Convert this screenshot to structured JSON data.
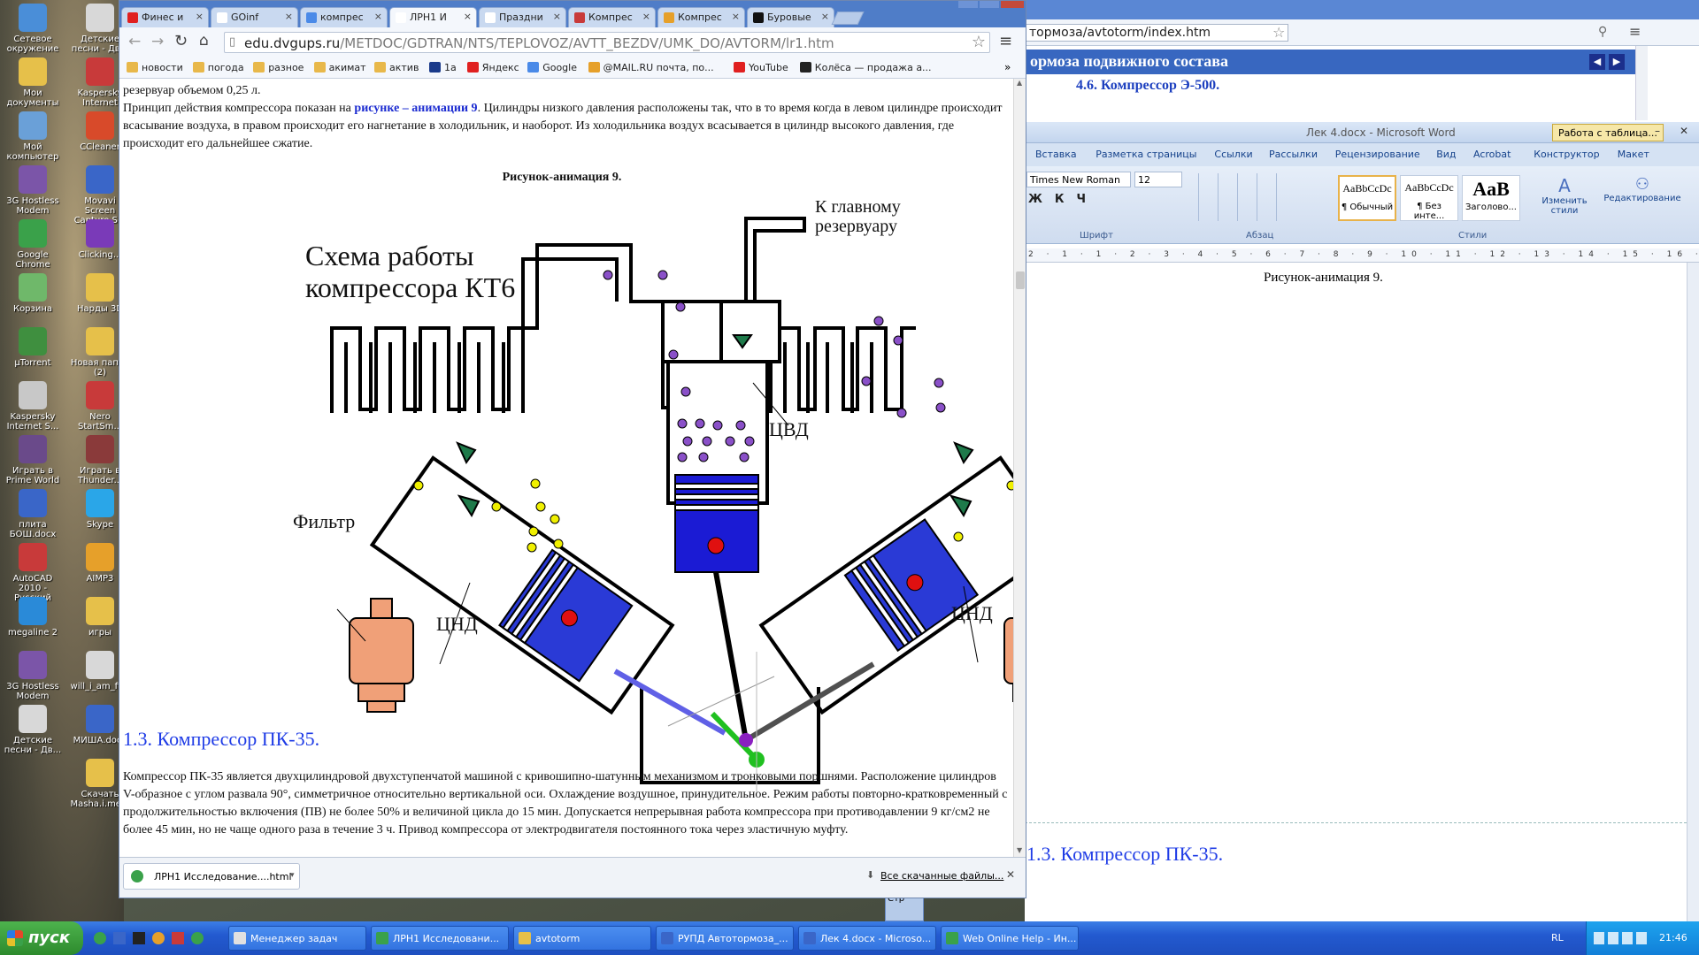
{
  "desktop": {
    "icons": [
      {
        "label": "Сетевое окружение",
        "color": "#4a8ed8"
      },
      {
        "label": "Мои документы",
        "color": "#e6c04a"
      },
      {
        "label": "Мой компьютер",
        "color": "#6aa0d8"
      },
      {
        "label": "3G Hostless Modem",
        "color": "#7b55a8"
      },
      {
        "label": "Google Chrome",
        "color": "#3aa14a"
      },
      {
        "label": "Корзина",
        "color": "#6fb86a"
      },
      {
        "label": "µTorrent",
        "color": "#3f8f3f"
      },
      {
        "label": "Kaspersky Internet S...",
        "color": "#c8c8c8"
      },
      {
        "label": "Играть в Prime World",
        "color": "#6a4a8a"
      },
      {
        "label": "плита БОШ.docx",
        "color": "#3a66c8"
      },
      {
        "label": "AutoCAD 2010 - Русский",
        "color": "#c83a3a"
      },
      {
        "label": "megaline 2",
        "color": "#2a8ad8"
      },
      {
        "label": "3G Hostless Modem",
        "color": "#7b55a8"
      },
      {
        "label": "Детские песни - Дв...",
        "color": "#d8d8d8"
      }
    ],
    "icons2": [
      {
        "label": "Детские песни - Дв...",
        "color": "#d8d8d8"
      },
      {
        "label": "Kaspersky Internet",
        "color": "#c83a3a"
      },
      {
        "label": "CCleaner",
        "color": "#d84a2a"
      },
      {
        "label": "Movavi Screen Capture S...",
        "color": "#3a66c8"
      },
      {
        "label": "Clicking...",
        "color": "#7a3ab8"
      },
      {
        "label": "Нарды 3D",
        "color": "#e6c04a"
      },
      {
        "label": "Новая папка (2)",
        "color": "#e6c04a"
      },
      {
        "label": "Nero StartSm...",
        "color": "#c83a3a"
      },
      {
        "label": "Играть в Thunder...",
        "color": "#8a3a3a"
      },
      {
        "label": "Skype",
        "color": "#2aa6e8"
      },
      {
        "label": "AIMP3",
        "color": "#e6a02a"
      },
      {
        "label": "игры",
        "color": "#e6c04a"
      },
      {
        "label": "will_i_am_ft...",
        "color": "#d8d8d8"
      },
      {
        "label": "МИША.docx",
        "color": "#3a66c8"
      },
      {
        "label": "Скачать Masha.i.me...",
        "color": "#e6c04a"
      }
    ]
  },
  "ie_window": {
    "address": "тормоза/avtotorm/index.htm",
    "header": "ормоза подвижного состава",
    "subheader": "4.6. Компрессор Э-500."
  },
  "word": {
    "title": "Лек 4.docx - Microsoft Word",
    "context_tab": "Работа с таблица...",
    "tabs": [
      "Вставка",
      "Разметка страницы",
      "Ссылки",
      "Рассылки",
      "Рецензирование",
      "Вид",
      "Acrobat",
      "Конструктор",
      "Макет"
    ],
    "font_name": "Times New Roman",
    "font_size": "12",
    "groups": {
      "font": "Шрифт",
      "paragraph": "Абзац",
      "styles": "Стили"
    },
    "styles": [
      {
        "sample": "AaBbCcDc",
        "name": "¶ Обычный"
      },
      {
        "sample": "AaBbCcDc",
        "name": "¶ Без инте..."
      },
      {
        "sample": "AaB",
        "name": "Заголово..."
      }
    ],
    "change_styles": "Изменить стили",
    "editing": "Редактирование",
    "ruler": "2 · 1 · 1 · 2 · 3 · 4 · 5 · 6 · 7 · 8 · 9 · 10 · 11 · 12 · 13 · 14 · 15 · 16 · 17 · 18 · 19 · 20 · 21",
    "caption": "Рисунок-анимация 9.",
    "heading": "1.3. Компрессор ПК-35."
  },
  "chrome": {
    "tabs": [
      {
        "label": "Финес и",
        "color": "#e02020"
      },
      {
        "label": "GOinf",
        "color": "#ffffff"
      },
      {
        "label": "компрес",
        "color": "#4a8ae8"
      },
      {
        "label": "ЛРН1 И",
        "color": "#ffffff"
      },
      {
        "label": "Праздни",
        "color": "#ffffff"
      },
      {
        "label": "Компрес",
        "color": "#c83a3a"
      },
      {
        "label": "Компрес",
        "color": "#e6a02a"
      },
      {
        "label": "Буровые",
        "color": "#111111"
      }
    ],
    "active_tab": 3,
    "url_host": "edu.dvgups.ru",
    "url_path": "/METDOC/GDTRAN/NTS/TEPLOVOZ/AVTT_BEZDV/UMK_DO/AVTORM/lr1.htm",
    "bookmarks": [
      {
        "label": "новости",
        "color": "#e8b84a"
      },
      {
        "label": "погода",
        "color": "#e8b84a"
      },
      {
        "label": "разное",
        "color": "#e8b84a"
      },
      {
        "label": "акимат",
        "color": "#e8b84a"
      },
      {
        "label": "актив",
        "color": "#e8b84a"
      },
      {
        "label": "1а",
        "color": "#1a3a8a"
      },
      {
        "label": "Яндекс",
        "color": "#e02020"
      },
      {
        "label": "Google",
        "color": "#4a8ae8"
      },
      {
        "label": "@MAIL.RU почта, по...",
        "color": "#e6a02a"
      },
      {
        "label": "YouTube",
        "color": "#e02020"
      },
      {
        "label": "Колёса — продажа а...",
        "color": "#222222"
      }
    ],
    "bookmarks_more": "»",
    "page": {
      "line0": "резервуар объемом 0,25 л.",
      "para1_pre": "Принцип действия компрессора показан на ",
      "para1_link": "рисунке – анимации 9",
      "para1_post": ". Цилиндры низкого давления расположены так, что в то время когда в левом цилиндре происходит всасывание воздуха, в правом происходит его нагнетание в холодильник, и наоборот. Из холодильника воздух всасывается в цилиндр высокого давления, где происходит его дальнейшее сжатие.",
      "figure_caption": "Рисунок-анимация 9.",
      "section_heading": "1.3. Компрессор ПК-35.",
      "para2": "Компрессор ПК-35 является двухцилиндровой двухступенчатой машиной с кривошипно-шатунным механизмом и тронковыми поршнями. Расположение цилиндров V-образное с углом развала 90°, симметричное относительно вертикальной оси. Охлаждение воздушное, принудительное. Режим работы повторно-кратковременный с продолжительностью включения (ПВ) не более 50% и величиной цикла до 15 мин. Допускается непрерывная работа компрессора при противодавлении 9 кг/см2 не более 45 мин, но не чаще одного раза в течение 3 ч. Привод компрессора от электродвигателя постоянного тока через эластичную муфту."
    },
    "diagram": {
      "title_line1": "Схема работы",
      "title_line2": "компрессора КТ6",
      "to_main_line1": "К главному",
      "to_main_line2": "резервуару",
      "hp_label": "ЦВД",
      "filter_label": "Фильтр",
      "lp_left_label": "ЦНД",
      "lp_right_label": "ЦНД"
    },
    "download": {
      "file": "ЛРН1 Исследование....html",
      "all_downloads": "Все скачанные файлы..."
    }
  },
  "taskbar": {
    "start": "пуск",
    "buttons": [
      {
        "label": "Менеджер задач",
        "color": "#e0e0e0"
      },
      {
        "label": "ЛРН1 Исследовани...",
        "color": "#3aa14a"
      },
      {
        "label": "avtotorm",
        "color": "#e6c04a"
      },
      {
        "label": "РУПД Автотормоза_...",
        "color": "#3a66c8"
      },
      {
        "label": "Лек 4.docx - Microso...",
        "color": "#3a66c8"
      },
      {
        "label": "Web Online Help - Ин...",
        "color": "#3aa14a"
      }
    ],
    "lang": "RL",
    "clock": "21:46"
  }
}
